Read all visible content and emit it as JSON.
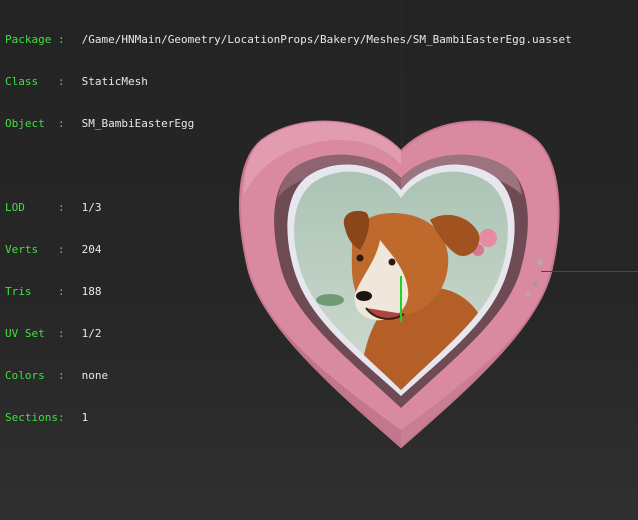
{
  "stats": {
    "package_label": "Package :",
    "package_value": "/Game/HNMain/Geometry/LocationProps/Bakery/Meshes/SM_BambiEasterEgg.uasset",
    "class_label": "Class   :",
    "class_value": "StaticMesh",
    "object_label": "Object  :",
    "object_value": "SM_BambiEasterEgg",
    "lod_label": "LOD     :",
    "lod_value": "1/3",
    "verts_label": "Verts   :",
    "verts_value": "204",
    "tris_label": "Tris    :",
    "tris_value": "188",
    "uvset_label": "UV Set  :",
    "uvset_value": "1/2",
    "colors_label": "Colors  :",
    "colors_value": "none",
    "sections_label": "Sections:",
    "sections_value": "1"
  },
  "colors": {
    "label": "#3fe03f",
    "value": "#e8e8e8",
    "frame": "#d98aa0",
    "frame_inner": "#6e4a54",
    "picture_bg": "#b9d0c3",
    "dog": "#c0692d",
    "axis_x": "#b81a1a",
    "axis_y": "#22d12a",
    "axis_z": "#1a1ab8"
  },
  "icons": {
    "mesh": "heart-frame-mesh",
    "portrait": "dog-portrait-image"
  }
}
